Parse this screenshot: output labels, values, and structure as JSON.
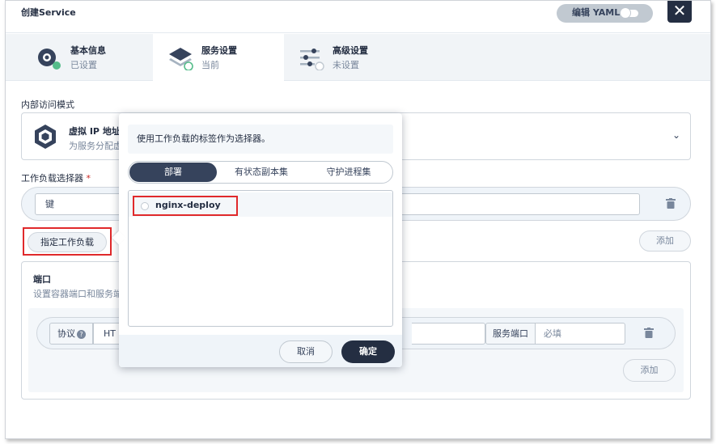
{
  "dialog": {
    "title": "创建Service",
    "yaml_toggle_label": "编辑 YAML",
    "close_symbol": "✕"
  },
  "steps": [
    {
      "name": "基本信息",
      "state": "已设置",
      "icon": "info-icon"
    },
    {
      "name": "服务设置",
      "state": "当前",
      "icon": "layers-icon"
    },
    {
      "name": "高级设置",
      "state": "未设置",
      "icon": "sliders-icon"
    }
  ],
  "access_mode": {
    "section_label": "内部访问模式",
    "title": "虚拟 IP 地址",
    "description": "为服务分配虚",
    "icon": "cube-icon"
  },
  "selector": {
    "section_label": "工作负载选择器",
    "required_mark": "*",
    "key_placeholder": "键",
    "assign_label": "指定工作负载",
    "add_label": "添加"
  },
  "ports": {
    "title": "端口",
    "description": "设置容器端口和服务端",
    "protocol_label": "协议",
    "help_symbol": "?",
    "protocol_value": "HT",
    "service_port_label": "服务端口",
    "service_port_placeholder": "必填",
    "add_label": "添加"
  },
  "popup": {
    "hint": "使用工作负载的标签作为选择器。",
    "tabs": [
      "部署",
      "有状态副本集",
      "守护进程集"
    ],
    "active_tab": 0,
    "items": [
      "nginx-deploy"
    ],
    "cancel_label": "取消",
    "ok_label": "确定"
  },
  "colors": {
    "primary_dark": "#242e42",
    "highlight_red": "#e0292b",
    "success_green": "#55bc8a",
    "muted_text": "#79879c"
  }
}
